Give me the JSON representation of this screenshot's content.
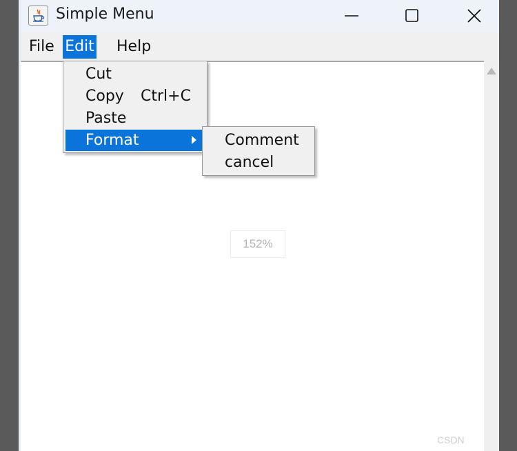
{
  "window": {
    "title": "Simple Menu",
    "icons": {
      "app": "java-cup-icon",
      "minimize": "minimize-icon",
      "maximize": "maximize-icon",
      "close": "close-icon"
    }
  },
  "menubar": {
    "items": [
      {
        "label": "File"
      },
      {
        "label": "Edit",
        "active": true
      },
      {
        "label": "Help"
      }
    ]
  },
  "edit_menu": {
    "items": [
      {
        "label": "Cut",
        "shortcut": ""
      },
      {
        "label": "Copy",
        "shortcut": "Ctrl+C"
      },
      {
        "label": "Paste",
        "shortcut": ""
      },
      {
        "label": "Format",
        "shortcut": "",
        "has_submenu": true,
        "highlighted": true
      }
    ]
  },
  "format_submenu": {
    "items": [
      {
        "label": "Comment"
      },
      {
        "label": "cancel"
      }
    ]
  },
  "overlay": {
    "zoom_level": "152%",
    "watermark": "CSDN"
  },
  "colors": {
    "selection": "#0a74da",
    "menu_background": "#f0f0f0",
    "titlebar_background": "#eef2f9"
  }
}
